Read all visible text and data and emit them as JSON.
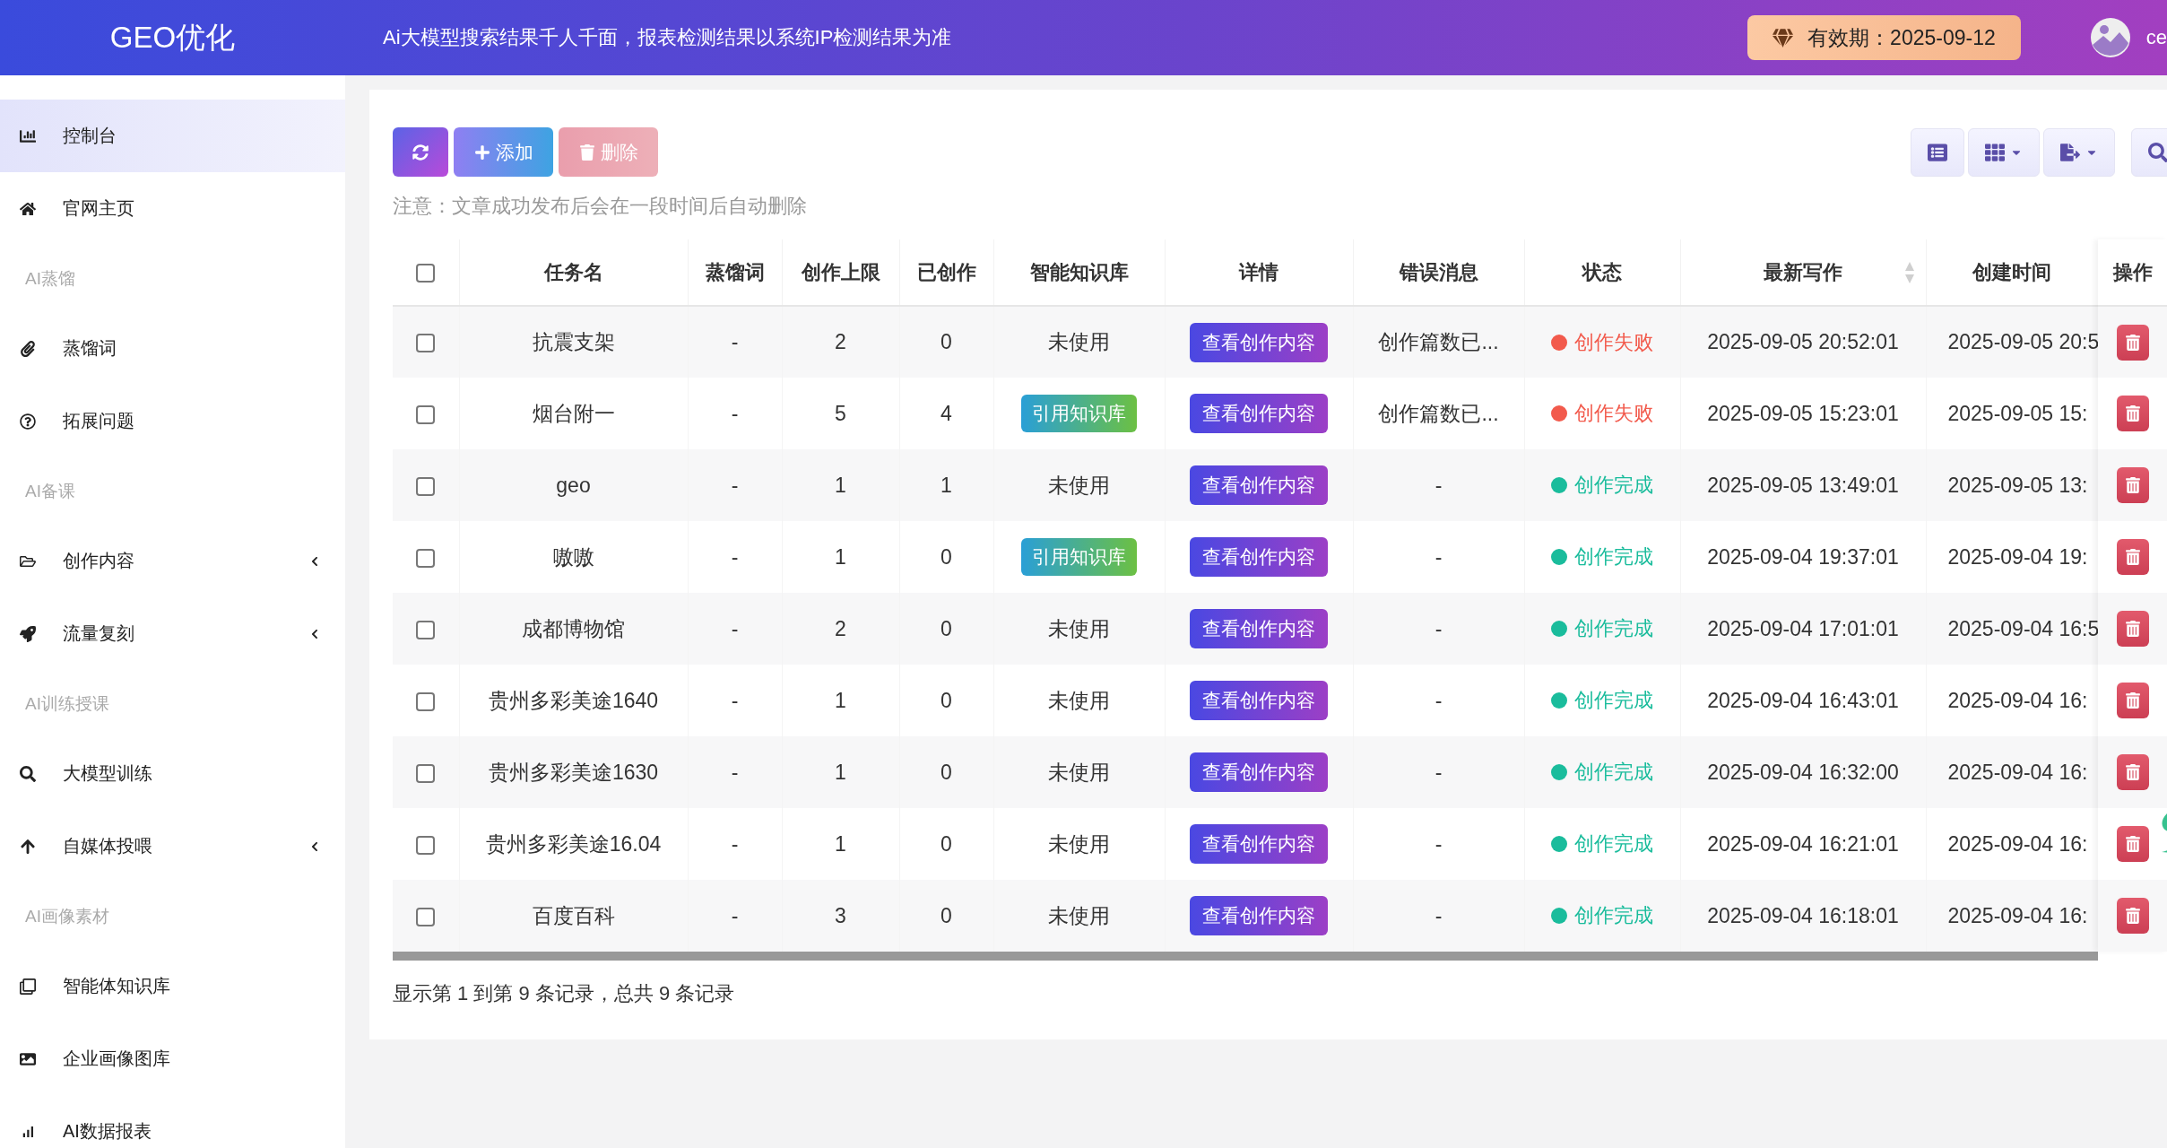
{
  "header": {
    "logo": "GEO优化",
    "notice": "Ai大模型搜索结果千人千面，报表检测结果以系统IP检测结果为准",
    "validity": "有效期：2025-09-12",
    "user": "ce"
  },
  "sidebar": {
    "items": [
      {
        "kind": "item",
        "label": "控制台",
        "selected": true,
        "expandable": false
      },
      {
        "kind": "item",
        "label": "官网主页",
        "selected": false,
        "expandable": false
      },
      {
        "kind": "section",
        "label": "AI蒸馏"
      },
      {
        "kind": "item",
        "label": "蒸馏词",
        "selected": false,
        "expandable": false
      },
      {
        "kind": "item",
        "label": "拓展问题",
        "selected": false,
        "expandable": false
      },
      {
        "kind": "section",
        "label": "AI备课"
      },
      {
        "kind": "item",
        "label": "创作内容",
        "selected": false,
        "expandable": true
      },
      {
        "kind": "item",
        "label": "流量复刻",
        "selected": false,
        "expandable": true
      },
      {
        "kind": "section",
        "label": "AI训练授课"
      },
      {
        "kind": "item",
        "label": "大模型训练",
        "selected": false,
        "expandable": false
      },
      {
        "kind": "item",
        "label": "自媒体投喂",
        "selected": false,
        "expandable": true
      },
      {
        "kind": "section",
        "label": "AI画像素材"
      },
      {
        "kind": "item",
        "label": "智能体知识库",
        "selected": false,
        "expandable": false
      },
      {
        "kind": "item",
        "label": "企业画像图库",
        "selected": false,
        "expandable": false
      },
      {
        "kind": "item",
        "label": "AI数据报表",
        "selected": false,
        "expandable": false
      }
    ]
  },
  "toolbar": {
    "buttons": [
      {
        "kind": "refresh",
        "disabled": false
      },
      {
        "kind": "add",
        "label": "添加",
        "disabled": false
      },
      {
        "kind": "delete",
        "label": "删除",
        "disabled": true
      }
    ],
    "note": "注意：文章成功发布后会在一段时间后自动删除"
  },
  "table": {
    "select_all": {
      "checked": false
    },
    "columns": [
      {
        "label": "任务名",
        "sortable": false
      },
      {
        "label": "蒸馏词",
        "sortable": false
      },
      {
        "label": "创作上限",
        "sortable": false
      },
      {
        "label": "已创作",
        "sortable": false
      },
      {
        "label": "智能知识库",
        "sortable": false
      },
      {
        "label": "详情",
        "sortable": false
      },
      {
        "label": "错误消息",
        "sortable": false
      },
      {
        "label": "状态",
        "sortable": false
      },
      {
        "label": "最新写作",
        "sortable": true
      },
      {
        "label": "创建时间",
        "sortable": false
      },
      {
        "label": "操作",
        "sortable": false
      }
    ],
    "rows": [
      {
        "checked": false,
        "name": "抗震支架",
        "keyword": "-",
        "limit": "2",
        "created": "0",
        "kb": {
          "kind": "text",
          "label": "未使用"
        },
        "detail": "查看创作内容",
        "error": "创作篇数已...",
        "status": {
          "label": "创作失败",
          "color": "#f25a4c"
        },
        "latest": "2025-09-05 20:52:01",
        "created_at": "2025-09-05 20:5"
      },
      {
        "checked": false,
        "name": "烟台附一",
        "keyword": "-",
        "limit": "5",
        "created": "4",
        "kb": {
          "kind": "tag",
          "label": "引用知识库"
        },
        "detail": "查看创作内容",
        "error": "创作篇数已...",
        "status": {
          "label": "创作失败",
          "color": "#f25a4c"
        },
        "latest": "2025-09-05 15:23:01",
        "created_at": "2025-09-05 15:"
      },
      {
        "checked": false,
        "name": "geo",
        "keyword": "-",
        "limit": "1",
        "created": "1",
        "kb": {
          "kind": "text",
          "label": "未使用"
        },
        "detail": "查看创作内容",
        "error": "-",
        "status": {
          "label": "创作完成",
          "color": "#1abc9c"
        },
        "latest": "2025-09-05 13:49:01",
        "created_at": "2025-09-05 13:"
      },
      {
        "checked": false,
        "name": "嗷嗷",
        "keyword": "-",
        "limit": "1",
        "created": "0",
        "kb": {
          "kind": "tag",
          "label": "引用知识库"
        },
        "detail": "查看创作内容",
        "error": "-",
        "status": {
          "label": "创作完成",
          "color": "#1abc9c"
        },
        "latest": "2025-09-04 19:37:01",
        "created_at": "2025-09-04 19:"
      },
      {
        "checked": false,
        "name": "成都博物馆",
        "keyword": "-",
        "limit": "2",
        "created": "0",
        "kb": {
          "kind": "text",
          "label": "未使用"
        },
        "detail": "查看创作内容",
        "error": "-",
        "status": {
          "label": "创作完成",
          "color": "#1abc9c"
        },
        "latest": "2025-09-04 17:01:01",
        "created_at": "2025-09-04 16:5"
      },
      {
        "checked": false,
        "name": "贵州多彩美途1640",
        "keyword": "-",
        "limit": "1",
        "created": "0",
        "kb": {
          "kind": "text",
          "label": "未使用"
        },
        "detail": "查看创作内容",
        "error": "-",
        "status": {
          "label": "创作完成",
          "color": "#1abc9c"
        },
        "latest": "2025-09-04 16:43:01",
        "created_at": "2025-09-04 16:"
      },
      {
        "checked": false,
        "name": "贵州多彩美途1630",
        "keyword": "-",
        "limit": "1",
        "created": "0",
        "kb": {
          "kind": "text",
          "label": "未使用"
        },
        "detail": "查看创作内容",
        "error": "-",
        "status": {
          "label": "创作完成",
          "color": "#1abc9c"
        },
        "latest": "2025-09-04 16:32:00",
        "created_at": "2025-09-04 16:"
      },
      {
        "checked": false,
        "name": "贵州多彩美途16.04",
        "keyword": "-",
        "limit": "1",
        "created": "0",
        "kb": {
          "kind": "text",
          "label": "未使用"
        },
        "detail": "查看创作内容",
        "error": "-",
        "status": {
          "label": "创作完成",
          "color": "#1abc9c"
        },
        "latest": "2025-09-04 16:21:01",
        "created_at": "2025-09-04 16:"
      },
      {
        "checked": false,
        "name": "百度百科",
        "keyword": "-",
        "limit": "3",
        "created": "0",
        "kb": {
          "kind": "text",
          "label": "未使用"
        },
        "detail": "查看创作内容",
        "error": "-",
        "status": {
          "label": "创作完成",
          "color": "#1abc9c"
        },
        "latest": "2025-09-04 16:18:01",
        "created_at": "2025-09-04 16:"
      }
    ]
  },
  "footer": "显示第 1 到第 9 条记录，总共 9 条记录"
}
